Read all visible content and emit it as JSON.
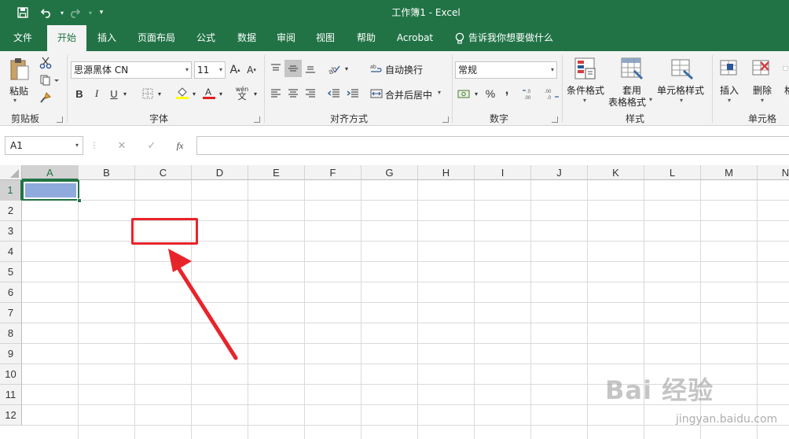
{
  "window": {
    "title": "工作簿1  -  Excel"
  },
  "quick_access": {
    "save_icon": "save-icon",
    "undo_icon": "undo-icon",
    "redo_icon": "redo-icon",
    "customize_icon": "customize-icon"
  },
  "tabs": [
    {
      "label": "文件"
    },
    {
      "label": "开始"
    },
    {
      "label": "插入"
    },
    {
      "label": "页面布局"
    },
    {
      "label": "公式"
    },
    {
      "label": "数据"
    },
    {
      "label": "审阅"
    },
    {
      "label": "视图"
    },
    {
      "label": "帮助"
    },
    {
      "label": "Acrobat"
    }
  ],
  "tell_me": "告诉我你想要做什么",
  "ribbon": {
    "clipboard": {
      "paste": "粘贴",
      "label": "剪贴板"
    },
    "font": {
      "name": "思源黑体 CN",
      "size": "11",
      "label": "字体",
      "bold": "B",
      "italic": "I",
      "underline": "U",
      "grow": "A",
      "shrink": "A",
      "phonetic_top": "wén",
      "phonetic_bottom": "文"
    },
    "alignment": {
      "wrap": "自动换行",
      "merge": "合并后居中",
      "label": "对齐方式"
    },
    "number": {
      "format": "常规",
      "label": "数字",
      "percent": "%",
      "comma": ","
    },
    "styles": {
      "conditional": "条件格式",
      "table_line1": "套用",
      "table_line2": "表格格式",
      "cell_styles": "单元格样式",
      "label": "样式"
    },
    "cells": {
      "insert": "插入",
      "delete": "删除",
      "format_partial": "格",
      "label": "单元格"
    }
  },
  "formula_bar": {
    "name_box": "A1",
    "cancel": "✕",
    "enter": "✓",
    "fx": "fx",
    "value": ""
  },
  "grid": {
    "columns": [
      "A",
      "B",
      "C",
      "D",
      "E",
      "F",
      "G",
      "H",
      "I",
      "J",
      "K",
      "L",
      "M",
      "N"
    ],
    "rows": [
      "1",
      "2",
      "3",
      "4",
      "5",
      "6",
      "7",
      "8",
      "9",
      "10",
      "11",
      "12"
    ],
    "active_cell": "A1"
  },
  "watermark": {
    "logo": "Bai 经验",
    "url": "jingyan.baidu.com"
  },
  "colors": {
    "accent": "#217346",
    "selection": "#8faadc",
    "annotation": "#e8242b"
  }
}
